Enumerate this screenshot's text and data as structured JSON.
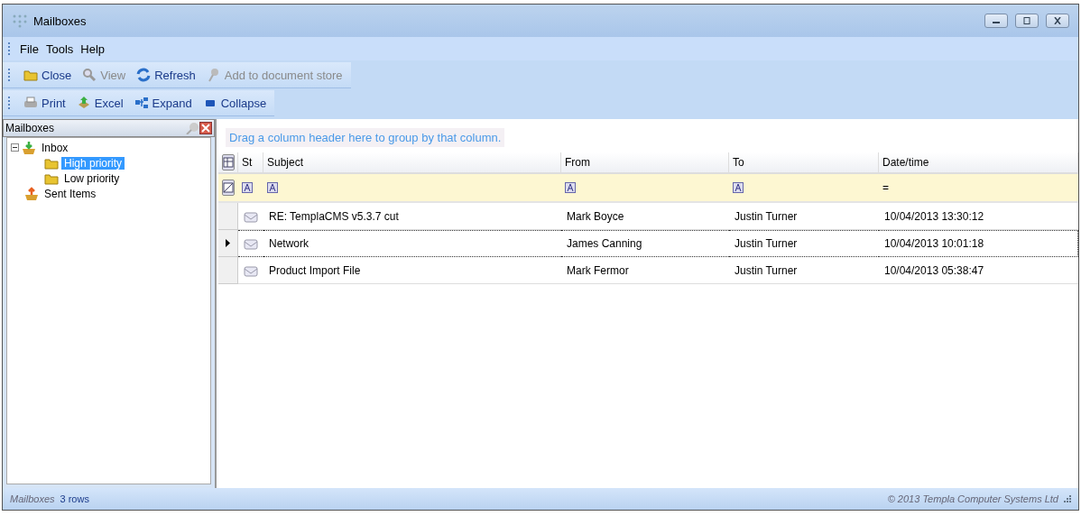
{
  "window": {
    "title": "Mailboxes"
  },
  "menu": [
    "File",
    "Tools",
    "Help"
  ],
  "toolbars": [
    [
      {
        "label": "Close",
        "disabled": false
      },
      {
        "label": "View",
        "disabled": true
      },
      {
        "label": "Refresh",
        "disabled": false
      },
      {
        "label": "Add to document store",
        "disabled": true
      }
    ],
    [
      {
        "label": "Print",
        "disabled": false
      },
      {
        "label": "Excel",
        "disabled": false
      },
      {
        "label": "Expand",
        "disabled": false
      },
      {
        "label": "Collapse",
        "disabled": false
      }
    ]
  ],
  "sidebar": {
    "title": "Mailboxes",
    "items": [
      {
        "label": "Inbox",
        "selected": false,
        "expanded": true,
        "children": [
          {
            "label": "High priority",
            "selected": true
          },
          {
            "label": "Low priority",
            "selected": false
          }
        ]
      },
      {
        "label": "Sent Items",
        "selected": false
      }
    ]
  },
  "grid": {
    "group_hint": "Drag a column header here to group by that column.",
    "columns": [
      {
        "label": "St"
      },
      {
        "label": "Subject"
      },
      {
        "label": "From"
      },
      {
        "label": "To"
      },
      {
        "label": "Date/time",
        "filter": "="
      }
    ],
    "rows": [
      {
        "subject": "RE: TemplaCMS v5.3.7 cut",
        "from": "Mark Boyce",
        "to": "Justin Turner",
        "date": "10/04/2013  13:30:12",
        "selected": false
      },
      {
        "subject": "Network",
        "from": "James Canning",
        "to": "Justin Turner",
        "date": "10/04/2013  10:01:18",
        "selected": true
      },
      {
        "subject": "Product Import File",
        "from": "Mark Fermor",
        "to": "Justin Turner",
        "date": "10/04/2013  05:38:47",
        "selected": false
      }
    ]
  },
  "status_bar": {
    "name": "Mailboxes",
    "count": "3 rows",
    "copyright": "© 2013 Templa Computer Systems Ltd"
  }
}
